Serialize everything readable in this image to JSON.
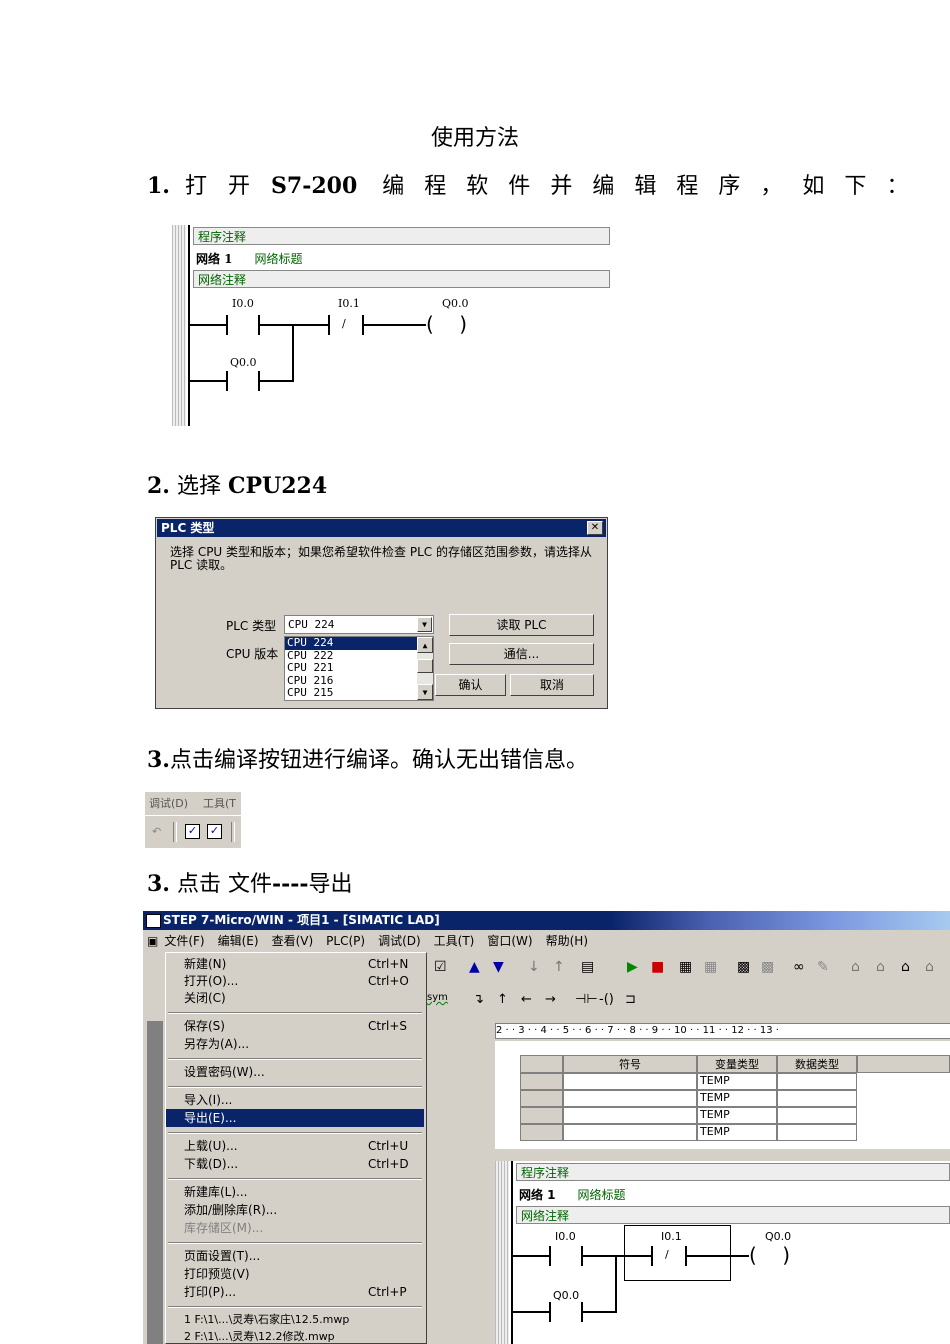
{
  "doc": {
    "title": "使用方法",
    "step1": [
      "1.",
      "打",
      "开",
      "S7-200",
      "编",
      "程",
      "软",
      "件",
      "并",
      "编",
      "辑",
      "程",
      "序",
      "，",
      "如",
      "下",
      "："
    ],
    "step2_num": "2.",
    "step2_text": "选择 ",
    "step2_bold": "CPU224",
    "step3a_num": "3.",
    "step3a_text": "点击编译按钮进行编译。确认无出错信息。",
    "step3b_num": "3.",
    "step3b_text": " 点击  文件",
    "step3b_bold": "----",
    "step3b_tail": "导出"
  },
  "ladder": {
    "program_comment": "程序注释",
    "network": "网络 1",
    "network_title": "网络标题",
    "network_comment": "网络注释",
    "contact1": "I0.0",
    "contact2": "I0.1",
    "coil": "Q0.0",
    "contact3": "Q0.0",
    "nc_symbol": "/"
  },
  "dialog": {
    "title": "PLC 类型",
    "close": "✕",
    "text": "选择 CPU 类型和版本；如果您希望软件检查 PLC 的存储区范围参数，请选择从 PLC 读取。",
    "plc_type_label": "PLC 类型",
    "plc_type_value": "CPU 224",
    "cpu_version_label": "CPU 版本",
    "options": [
      "CPU 224",
      "CPU 222",
      "CPU 221",
      "CPU 216",
      "CPU 215"
    ],
    "read_plc": "读取 PLC",
    "comm": "通信...",
    "ok": "确认",
    "cancel": "取消"
  },
  "toolbar_snip": {
    "menu1": "调试(D)",
    "menu2": "工具(T"
  },
  "app": {
    "title": "STEP 7-Micro/WIN - 项目1 - [SIMATIC LAD]",
    "menus": [
      "文件(F)",
      "编辑(E)",
      "查看(V)",
      "PLC(P)",
      "调试(D)",
      "工具(T)",
      "窗口(W)",
      "帮助(H)"
    ],
    "file_menu": [
      {
        "label": "新建(N)",
        "shortcut": "Ctrl+N"
      },
      {
        "label": "打开(O)...",
        "shortcut": "Ctrl+O"
      },
      {
        "label": "关闭(C)",
        "shortcut": ""
      },
      {
        "label": "保存(S)",
        "shortcut": "Ctrl+S"
      },
      {
        "label": "另存为(A)...",
        "shortcut": ""
      },
      {
        "label": "设置密码(W)...",
        "shortcut": ""
      },
      {
        "label": "导入(I)...",
        "shortcut": ""
      },
      {
        "label": "导出(E)...",
        "shortcut": ""
      },
      {
        "label": "上载(U)...",
        "shortcut": "Ctrl+U"
      },
      {
        "label": "下载(D)...",
        "shortcut": "Ctrl+D"
      },
      {
        "label": "新建库(L)...",
        "shortcut": ""
      },
      {
        "label": "添加/删除库(R)...",
        "shortcut": ""
      },
      {
        "label": "库存储区(M)...",
        "shortcut": ""
      },
      {
        "label": "页面设置(T)...",
        "shortcut": ""
      },
      {
        "label": "打印预览(V)",
        "shortcut": ""
      },
      {
        "label": "打印(P)...",
        "shortcut": "Ctrl+P"
      },
      {
        "label": "1 F:\\1\\...\\灵寿\\石家庄\\12.5.mwp",
        "shortcut": ""
      },
      {
        "label": "2 F:\\1\\...\\灵寿\\12.2修改.mwp",
        "shortcut": ""
      }
    ],
    "sym": "sym",
    "ruler": "2 · · 3 · · 4 · · 5 · · 6 · · 7 · · 8 · · 9 · · 10 · · 11 · · 12 · · 13 ·",
    "table_headers": [
      "符号",
      "变量类型",
      "数据类型"
    ],
    "temp": "TEMP"
  }
}
